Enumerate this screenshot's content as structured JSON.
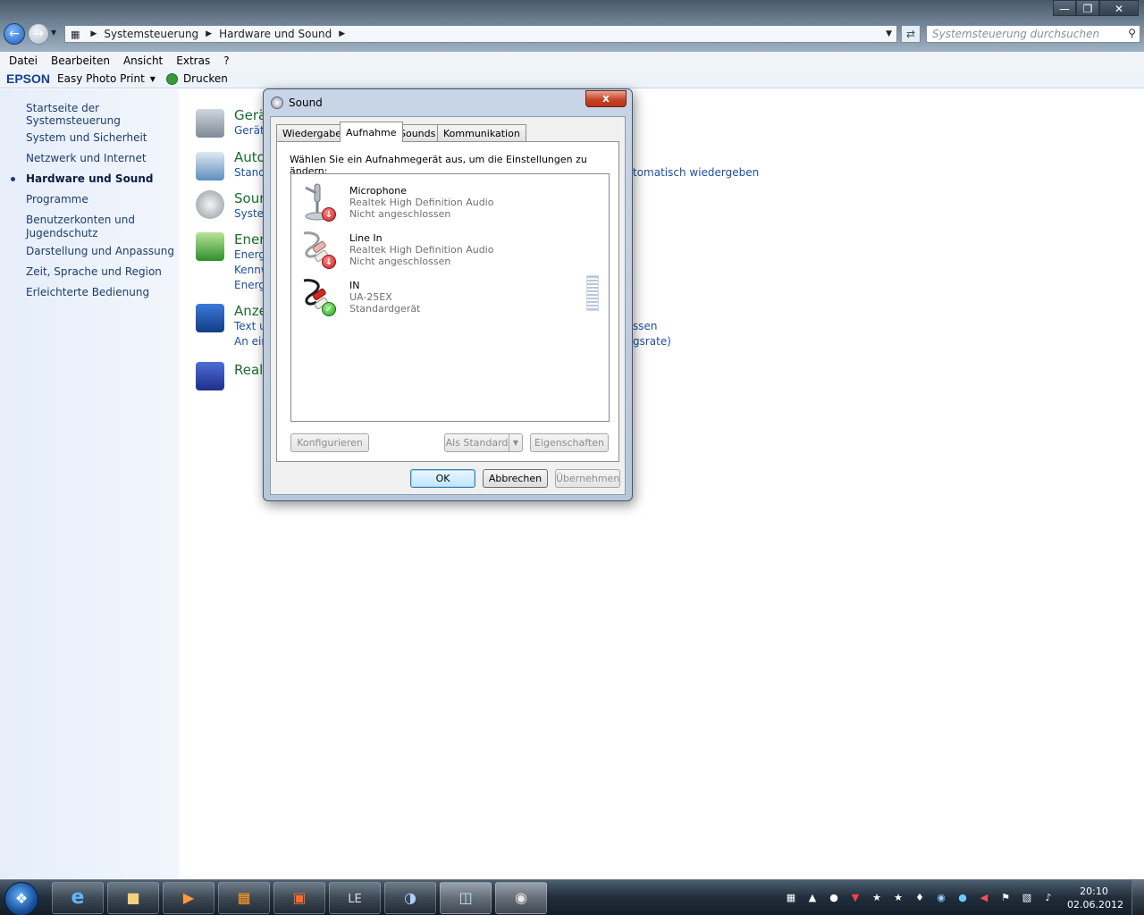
{
  "window": {
    "minimize": "—",
    "maximize": "❐",
    "close": "✕",
    "breadcrumb": [
      "Systemsteuerung",
      "Hardware und Sound"
    ],
    "search_placeholder": "Systemsteuerung durchsuchen"
  },
  "menu": [
    "Datei",
    "Bearbeiten",
    "Ansicht",
    "Extras",
    "?"
  ],
  "toolbar": {
    "brand": "EPSON",
    "app": "Easy Photo Print",
    "print": "Drucken"
  },
  "leftnav": [
    "Startseite der Systemsteuerung",
    "System und Sicherheit",
    "Netzwerk und Internet",
    "Hardware und Sound",
    "Programme",
    "Benutzerkonten und",
    "Jugendschutz",
    "Darstellung und Anpassung",
    "Zeit, Sprache und Region",
    "Erleichterte Bedienung"
  ],
  "categories": [
    {
      "title": "Gerä",
      "links": [
        "Gerät"
      ]
    },
    {
      "title": "Auto",
      "links": [
        "Standa",
        "tomatisch wiedergeben"
      ]
    },
    {
      "title": "Sour",
      "links": [
        "Systen"
      ]
    },
    {
      "title": "Ener",
      "links": [
        "Energi",
        "Kennw",
        "Energi"
      ]
    },
    {
      "title": "Anze",
      "links": [
        "Text u",
        "An ein",
        "ssen",
        "gsrate)"
      ]
    },
    {
      "title": "Realt",
      "links": []
    }
  ],
  "dialog": {
    "title": "Sound",
    "close": "x",
    "tabs": [
      "Wiedergabe",
      "Aufnahme",
      "Sounds",
      "Kommunikation"
    ],
    "active_tab": "Aufnahme",
    "instruction": "Wählen Sie ein Aufnahmegerät aus, um die Einstellungen zu ändern:",
    "devices": [
      {
        "name": "Microphone",
        "driver": "Realtek High Definition Audio",
        "status": "Nicht angeschlossen",
        "badge": "disconnected-icon"
      },
      {
        "name": "Line In",
        "driver": "Realtek High Definition Audio",
        "status": "Nicht angeschlossen",
        "badge": "disconnected-icon"
      },
      {
        "name": "IN",
        "driver": "UA-25EX",
        "status": "Standardgerät",
        "badge": "default-check-icon"
      }
    ],
    "buttons": {
      "configure": "Konfigurieren",
      "set_default": "Als Standard",
      "properties": "Eigenschaften",
      "ok": "OK",
      "cancel": "Abbrechen",
      "apply": "Übernehmen"
    }
  },
  "taskbar": {
    "clock_time": "20:10",
    "clock_date": "02.06.2012"
  }
}
